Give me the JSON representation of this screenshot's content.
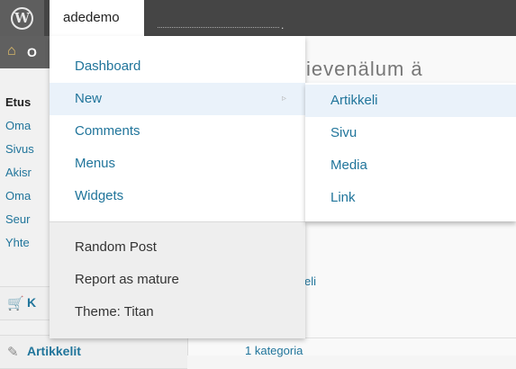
{
  "adminbar": {
    "logo_glyph": "W",
    "site_name": "adedemo",
    "accent": "#454545"
  },
  "sidebar": {
    "header_label": "O",
    "items": [
      {
        "label": "Etus",
        "bold": true
      },
      {
        "label": "Oma"
      },
      {
        "label": "Sivus"
      },
      {
        "label": "Akisr"
      },
      {
        "label": "Oma"
      },
      {
        "label": "Seur"
      },
      {
        "label": "Yhte"
      }
    ],
    "section_cart": {
      "label": "K",
      "icon": "cart-icon"
    },
    "section_articles": {
      "label": "Artikkelit",
      "icon": "pin-icon"
    }
  },
  "main": {
    "heading_fragment": "ievenälum ä",
    "text1": "eli",
    "text2": "1  kategoria"
  },
  "menu": {
    "items": [
      {
        "label": "Dashboard"
      },
      {
        "label": "New",
        "active": true,
        "has_submenu": true
      },
      {
        "label": "Comments"
      },
      {
        "label": "Menus"
      },
      {
        "label": "Widgets"
      }
    ],
    "lower_items": [
      {
        "label": "Random Post"
      },
      {
        "label": "Report as mature"
      },
      {
        "label": "Theme: Titan"
      }
    ],
    "arrow_glyph": "▹"
  },
  "submenu": {
    "items": [
      {
        "label": "Artikkeli",
        "active": true
      },
      {
        "label": "Sivu"
      },
      {
        "label": "Media"
      },
      {
        "label": "Link"
      }
    ]
  },
  "colors": {
    "link": "#21759b",
    "highlight": "#eaf2fa"
  }
}
